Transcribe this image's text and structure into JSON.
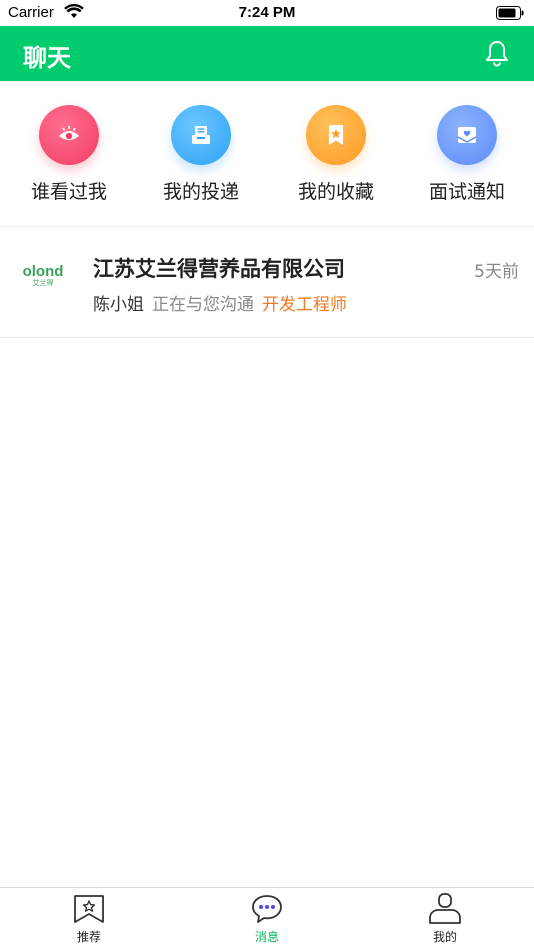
{
  "status_bar": {
    "carrier": "Carrier",
    "time": "7:24 PM"
  },
  "header": {
    "title": "聊天"
  },
  "quick_actions": [
    {
      "label": "谁看过我",
      "icon": "eye-icon",
      "color": "#F23D63"
    },
    {
      "label": "我的投递",
      "icon": "mailbox-icon",
      "color": "#2FA1F5"
    },
    {
      "label": "我的收藏",
      "icon": "star-bookmark-icon",
      "color": "#FF9A24"
    },
    {
      "label": "面试通知",
      "icon": "heart-envelope-icon",
      "color": "#5B8CF7"
    }
  ],
  "messages": [
    {
      "logo_text": "olond",
      "logo_subtext": "艾兰得",
      "company": "江苏艾兰得营养品有限公司",
      "time": "5天前",
      "contact": "陈小姐",
      "status": "正在与您沟通",
      "position": "开发工程师"
    }
  ],
  "tabs": [
    {
      "label": "推荐",
      "icon": "star-bookmark-icon",
      "active": false
    },
    {
      "label": "消息",
      "icon": "chat-bubble-icon",
      "active": true
    },
    {
      "label": "我的",
      "icon": "user-icon",
      "active": false
    }
  ],
  "colors": {
    "brand_green": "#00CC6E",
    "accent_orange": "#F07A24",
    "active_tab": "#00B862"
  }
}
